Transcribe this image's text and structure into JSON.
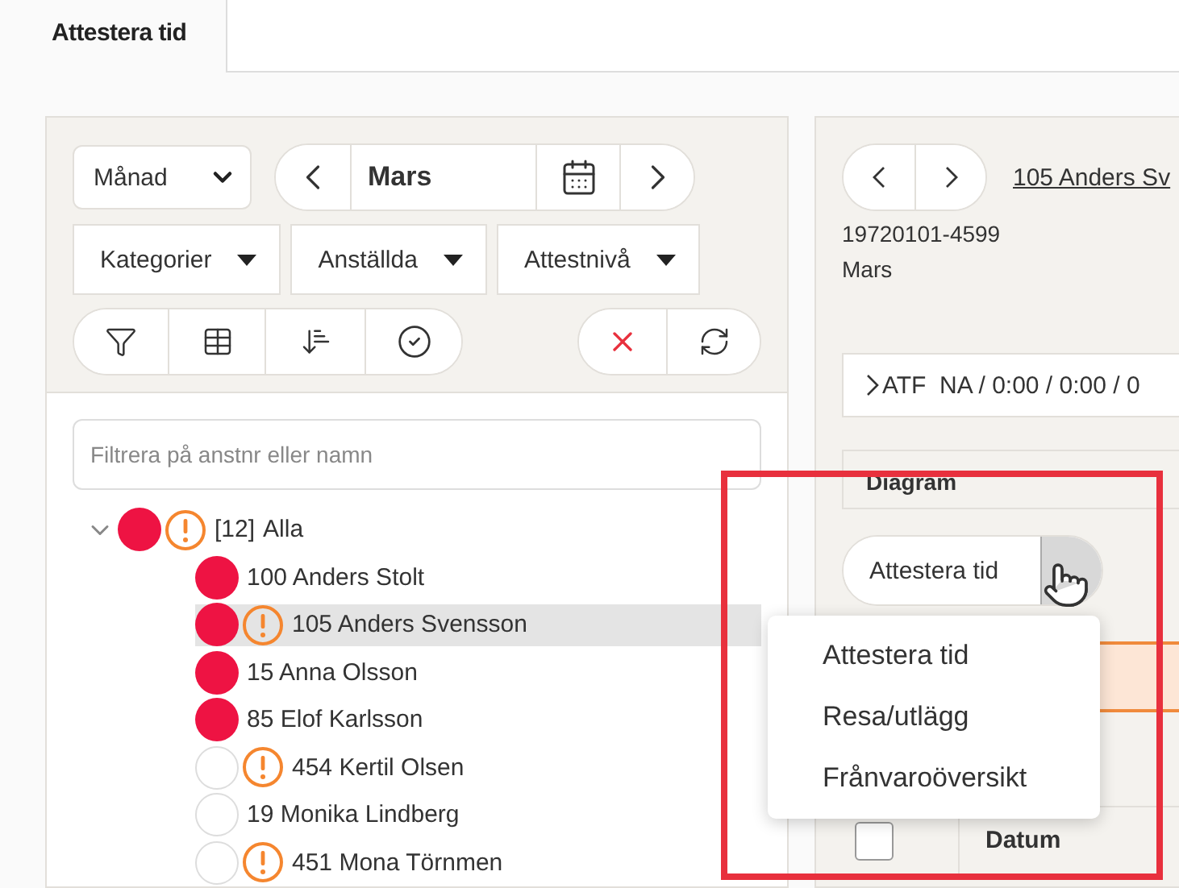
{
  "tabs": [
    {
      "label": "Attestera tid",
      "selected": true
    }
  ],
  "left_panel": {
    "period_select": {
      "value": "Månad"
    },
    "period_nav": {
      "label": "Mars"
    },
    "filters": [
      "Kategorier",
      "Anställda",
      "Attestnivå"
    ],
    "search": {
      "placeholder": "Filtrera på anstnr eller namn"
    },
    "tree": [
      {
        "count": "[12]",
        "label": "Alla",
        "expanded": true,
        "flagged": true,
        "warning": true,
        "selected": false,
        "children": [
          {
            "label": "100 Anders Stolt",
            "flagged": true,
            "warning": false,
            "selected": false
          },
          {
            "label": "105 Anders Svensson",
            "flagged": true,
            "warning": true,
            "selected": true
          },
          {
            "label": "15 Anna Olsson",
            "flagged": true,
            "warning": false,
            "selected": false
          },
          {
            "label": "85 Elof Karlsson",
            "flagged": true,
            "warning": false,
            "selected": false
          },
          {
            "label": "454 Kertil Olsen",
            "flagged": false,
            "warning": true,
            "selected": false
          },
          {
            "label": "19 Monika Lindberg",
            "flagged": false,
            "warning": false,
            "selected": false
          },
          {
            "label": "451 Mona Törnmen",
            "flagged": false,
            "warning": true,
            "selected": false
          }
        ]
      }
    ]
  },
  "right_panel": {
    "employee_link": "105 Anders Sv",
    "employee_id": "19720101-4599",
    "period": "Mars",
    "summary": {
      "label": "ATF  NA / 0:00 / 0:00 / 0",
      "expanded": false
    },
    "section": "Diagram",
    "split_button": {
      "label": "Attestera tid"
    },
    "table": {
      "select_all_checked": false,
      "columns": [
        "Datum"
      ]
    },
    "menu": [
      "Attestera tid",
      "Resa/utlägg",
      "Frånvaroöversikt"
    ]
  }
}
